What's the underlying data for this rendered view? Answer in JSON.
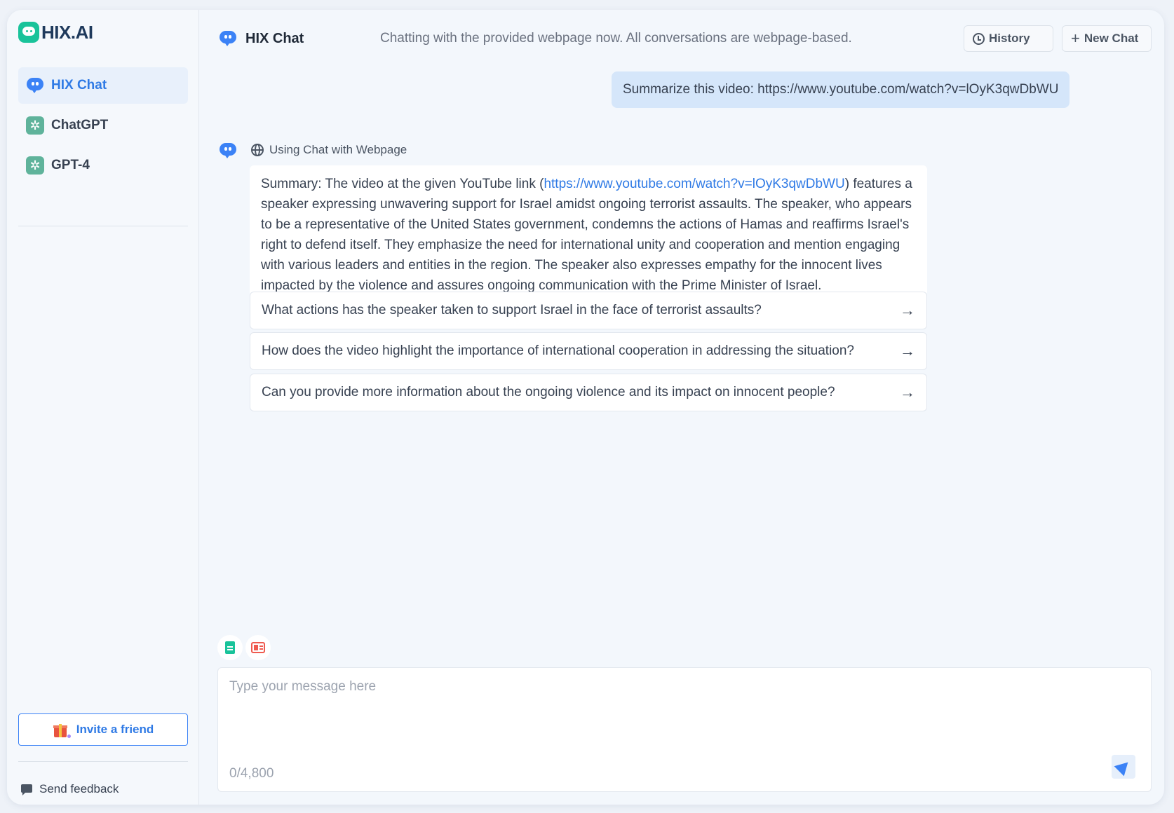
{
  "brand": {
    "name": "HIX.AI",
    "accent": "#3b82f6",
    "logo_color": "#19c39a"
  },
  "sidebar": {
    "items": [
      {
        "label": "HIX Chat",
        "icon": "chat-bubble-icon",
        "active": true
      },
      {
        "label": "ChatGPT",
        "icon": "openai-icon",
        "active": false
      },
      {
        "label": "GPT-4",
        "icon": "openai-icon",
        "active": false
      }
    ],
    "invite_label": "Invite a friend",
    "feedback_label": "Send feedback"
  },
  "header": {
    "title": "HIX Chat",
    "subtitle": "Chatting with the provided webpage now. All conversations are webpage-based.",
    "history_label": "History",
    "new_chat_label": "New Chat"
  },
  "conversation": {
    "user_message": "Summarize this video: https://www.youtube.com/watch?v=lOyK3qwDbWU",
    "mode_label": "Using Chat with Webpage",
    "answer_prefix": "Summary: The video at the given YouTube link (",
    "answer_link": "https://www.youtube.com/watch?v=lOyK3qwDbWU",
    "answer_body": ") features a speaker expressing unwavering support for Israel amidst ongoing terrorist assaults. The speaker, who appears to be a representative of the United States government, condemns the actions of Hamas and reaffirms Israel's right to defend itself. They emphasize the need for international unity and cooperation and mention engaging with various leaders and entities in the region. The speaker also expresses empathy for the innocent lives impacted by the violence and assures ongoing communication with the Prime Minister of Israel.",
    "suggestions": [
      "What actions has the speaker taken to support Israel in the face of terrorist assaults?",
      "How does the video highlight the importance of international cooperation in addressing the situation?",
      "Can you provide more information about the ongoing violence and its impact on innocent people?"
    ]
  },
  "composer": {
    "placeholder": "Type your message here",
    "counter": "0/4,800"
  }
}
